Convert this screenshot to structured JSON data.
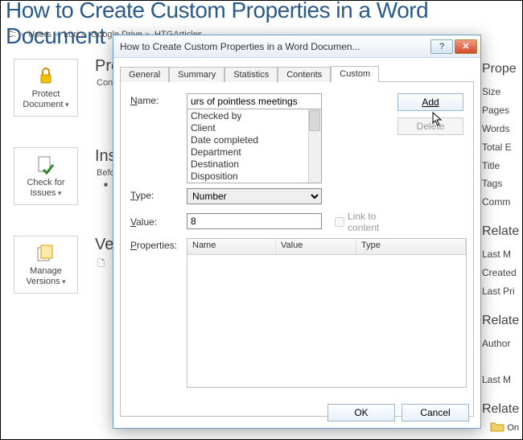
{
  "page": {
    "title": "How to Create Custom Properties in a Word Document",
    "breadcrumb": [
      "C:",
      "Users",
      "Lori",
      "Google Drive",
      "HTGArticles"
    ]
  },
  "side_buttons": {
    "protect": "Protect Document",
    "check": "Check for Issues",
    "manage": "Manage Versions"
  },
  "sections": {
    "protect_title": "Protect Document",
    "protect_sub": "Con",
    "inspect_title": "Ins",
    "inspect_sub": "Befo",
    "inspect_bullet": "■",
    "versions_title": "Ve",
    "versions_icon": "🗋"
  },
  "right_col": {
    "hdr1": "Prope",
    "items1": [
      "Size",
      "Pages",
      "Words",
      "Total E",
      "Title",
      "Tags",
      "Comm"
    ],
    "hdr2": "Relate",
    "items2": [
      "Last M",
      "Created",
      "Last Pri"
    ],
    "hdr3": "Relate",
    "items3": [
      "Author"
    ],
    "last": "Last M",
    "hdr4": "Relate",
    "open": "On"
  },
  "dialog": {
    "title": "How to Create Custom Properties in a Word Documen...",
    "tabs": [
      "General",
      "Summary",
      "Statistics",
      "Contents",
      "Custom"
    ],
    "active_tab": 4,
    "labels": {
      "name": "Name:",
      "type": "Type:",
      "value": "Value:",
      "properties": "Properties:",
      "add": "Add",
      "delete": "Delete",
      "link": "Link to content",
      "ok": "OK",
      "cancel": "Cancel"
    },
    "name_value": "urs of pointless meetings",
    "name_list": [
      "Checked by",
      "Client",
      "Date completed",
      "Department",
      "Destination",
      "Disposition"
    ],
    "type_value": "Number",
    "value_value": "8",
    "columns": [
      "Name",
      "Value",
      "Type"
    ]
  }
}
